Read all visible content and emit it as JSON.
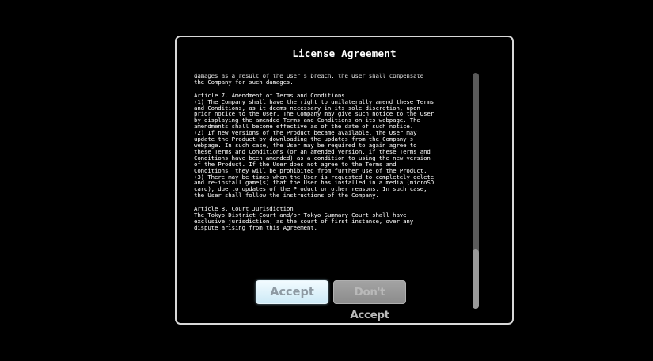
{
  "dialog": {
    "title": "License Agreement",
    "paragraphs": [
      "prior to the User's breach. In addition, if the Company suffers any\ndamages as a result of the User's breach, the User shall compensate\nthe Company for such damages.",
      "Article 7. Amendment of Terms and Conditions\n(1) The Company shall have the right to unilaterally amend these Terms\nand Conditions, as it deems necessary in its sole discretion, upon\nprior notice to the User. The Company may give such notice to the User\nby displaying the amended Terms and Conditions on its webpage. The\namendments shall become effective as of the date of such notice.\n(2) If new versions of the Product became available, the User may\nupdate the Product by downloading the updates from the Company's\nwebpage. In such case, the User may be required to again agree to\nthese Terms and Conditions (or an amended version, if these Terms and\nConditions have been amended) as a condition to using the new version\nof the Product. If the User does not agree to the Terms and\nConditions, they will be prohibited from further use of the Product.\n(3) There may be times when the User is requested to completely delete\nand re-install game(s) that the User has installed in a media (microSD\ncard), due to updates of the Product or other reasons. In such case,\nthe User shall follow the instructions of the Company.",
      "Article 8. Court Jurisdiction\nThe Tokyo District Court and/or Tokyo Summary Court shall have\nexclusive jurisdiction, as the court of first instance, over any\ndispute arising from this Agreement."
    ],
    "scroll_position_fraction": 1.0,
    "accept_label": "Accept",
    "decline_label": "Don't Accept"
  },
  "colors": {
    "background": "#000000",
    "frame_border": "#d8d8d8",
    "text": "#ffffff",
    "accept_button": "#dff3fb",
    "decline_button": "#989898"
  }
}
